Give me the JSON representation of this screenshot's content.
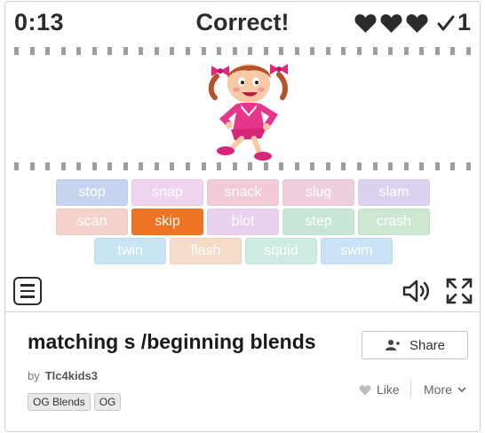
{
  "hud": {
    "timer": "0:13",
    "status": "Correct!",
    "lives": 3,
    "score": "1",
    "heart_icon": "heart-icon",
    "check_icon": "check-icon"
  },
  "tiles": {
    "rows": [
      [
        {
          "word": "stop",
          "color": "#c8d3ef"
        },
        {
          "word": "snap",
          "color": "#efd3ef"
        },
        {
          "word": "snack",
          "color": "#f2cbd6"
        },
        {
          "word": "slug",
          "color": "#efcedd"
        },
        {
          "word": "slam",
          "color": "#dcd2ef"
        }
      ],
      [
        {
          "word": "scan",
          "color": "#f5d2cc"
        },
        {
          "word": "skip",
          "color": "#ec7424",
          "selected": true
        },
        {
          "word": "blot",
          "color": "#e9d2ef"
        },
        {
          "word": "step",
          "color": "#c8e6d6"
        },
        {
          "word": "crash",
          "color": "#cde7d3"
        }
      ],
      [
        {
          "word": "twin",
          "color": "#c9e4f3"
        },
        {
          "word": "flash",
          "color": "#f5dcc9"
        },
        {
          "word": "squid",
          "color": "#cdebe0"
        },
        {
          "word": "swim",
          "color": "#c9e2f5"
        }
      ]
    ]
  },
  "controls": {
    "menu_icon": "menu-icon",
    "sound_icon": "speaker-icon",
    "fullscreen_icon": "fullscreen-icon"
  },
  "activity": {
    "title": "matching s /beginning blends",
    "by_label": "by",
    "author": "Tlc4kids3",
    "tags": [
      "OG Blends",
      "OG"
    ],
    "share_label": "Share",
    "like_label": "Like",
    "more_label": "More"
  }
}
